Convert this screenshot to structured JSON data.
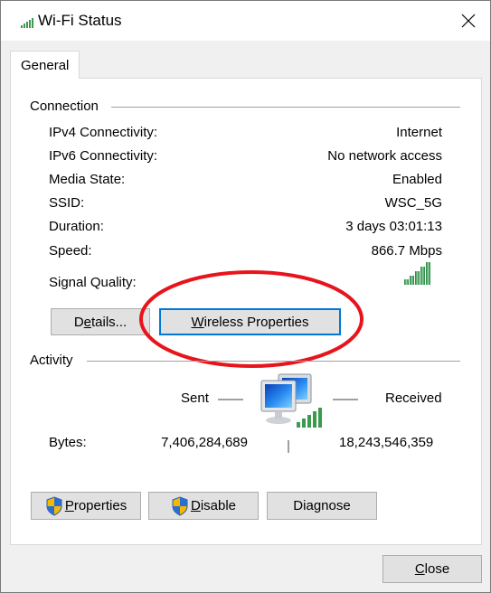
{
  "window": {
    "title": "Wi-Fi Status",
    "title_icon": "wifi-signal-icon",
    "close_icon": "close-icon"
  },
  "tabs": [
    {
      "label": "General",
      "selected": true
    }
  ],
  "connection": {
    "heading": "Connection",
    "rows": [
      {
        "label": "IPv4 Connectivity:",
        "value": "Internet"
      },
      {
        "label": "IPv6 Connectivity:",
        "value": "No network access"
      },
      {
        "label": "Media State:",
        "value": "Enabled"
      },
      {
        "label": "SSID:",
        "value": "WSC_5G"
      },
      {
        "label": "Duration:",
        "value": "3 days 03:01:13"
      },
      {
        "label": "Speed:",
        "value": "866.7 Mbps"
      }
    ],
    "signal_quality_label": "Signal Quality:",
    "signal_quality_bars": 5,
    "signal_quality_max_bars": 5,
    "details_button": {
      "pre": "D",
      "mnemonic": "e",
      "post": "tails..."
    },
    "wireless_properties_button": {
      "pre": "",
      "mnemonic": "W",
      "post": "ireless Properties"
    }
  },
  "activity": {
    "heading": "Activity",
    "sent_label": "Sent",
    "received_label": "Received",
    "bytes_label": "Bytes:",
    "bytes_sent": "7,406,284,689",
    "bytes_received": "18,243,546,359",
    "network_icon": "network-computers-icon"
  },
  "bottom_buttons": [
    {
      "pre": "",
      "mnemonic": "P",
      "post": "roperties",
      "icon": "uac-shield-icon"
    },
    {
      "pre": "",
      "mnemonic": "D",
      "post": "isable",
      "icon": "uac-shield-icon"
    },
    {
      "pre": "Dia",
      "mnemonic": "g",
      "post": "nose",
      "icon": ""
    }
  ],
  "close_button": {
    "pre": "",
    "mnemonic": "C",
    "post": "lose"
  },
  "annotation": {
    "type": "ellipse",
    "color": "#e8141c",
    "target": "Wireless Properties"
  }
}
